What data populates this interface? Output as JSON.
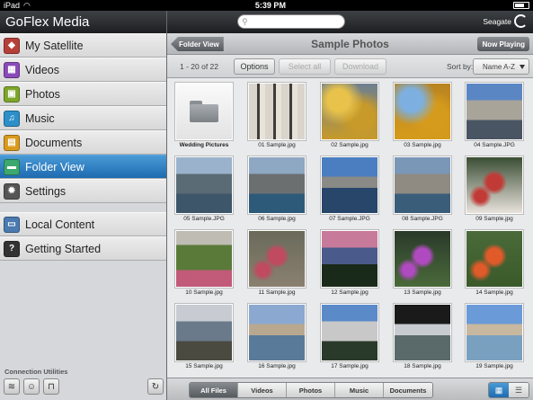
{
  "status_bar": {
    "device": "iPad",
    "time": "5:39 PM",
    "battery_percent": 0.6
  },
  "sidebar": {
    "title": "GoFlex Media",
    "items": [
      {
        "label": "My Satellite",
        "icon": "satellite-icon",
        "color": "#b5403a",
        "glyph": "◆",
        "selected": false
      },
      {
        "label": "Videos",
        "icon": "videos-icon",
        "color": "#8a4bb8",
        "glyph": "▦",
        "selected": false
      },
      {
        "label": "Photos",
        "icon": "photos-icon",
        "color": "#7ea62a",
        "glyph": "▣",
        "selected": false
      },
      {
        "label": "Music",
        "icon": "music-icon",
        "color": "#2d8fc9",
        "glyph": "♫",
        "selected": false
      },
      {
        "label": "Documents",
        "icon": "documents-icon",
        "color": "#d99a1d",
        "glyph": "▤",
        "selected": false
      },
      {
        "label": "Folder View",
        "icon": "folder-view-icon",
        "color": "#3aa86f",
        "glyph": "▬",
        "selected": true
      },
      {
        "label": "Settings",
        "icon": "settings-icon",
        "color": "#555555",
        "glyph": "✹",
        "selected": false
      }
    ],
    "items2": [
      {
        "label": "Local Content",
        "icon": "local-content-icon",
        "color": "#4a7ab0",
        "glyph": "▭"
      },
      {
        "label": "Getting Started",
        "icon": "getting-started-icon",
        "color": "#333333",
        "glyph": "?"
      }
    ],
    "footer_label": "Connection Utilities"
  },
  "topbar": {
    "search_placeholder": "",
    "brand": "Seagate"
  },
  "titlebar": {
    "back_label": "Folder View",
    "title": "Sample Photos",
    "now_playing_label": "Now Playing"
  },
  "toolbar": {
    "count": "1 - 20 of 22",
    "options_label": "Options",
    "select_all_label": "Select all",
    "download_label": "Download",
    "sort_label": "Sort by:",
    "sort_value": "Name A-Z"
  },
  "items": [
    {
      "name": "Wedding Pictures",
      "type": "folder"
    },
    {
      "name": "01 Sample.jpg",
      "colors": [
        "#d9d4cc",
        "#3f3d3a",
        "#e8e3d9"
      ],
      "style": "trees"
    },
    {
      "name": "02 Sample.jpg",
      "colors": [
        "#c79a2a",
        "#e8c24a",
        "#6d7f8f"
      ],
      "style": "foliage"
    },
    {
      "name": "03 Sample.jpg",
      "colors": [
        "#d59b1c",
        "#7db0e0",
        "#b98420"
      ],
      "style": "foliage"
    },
    {
      "name": "04 Sample.JPG",
      "colors": [
        "#5a86c4",
        "#a8a49a",
        "#4a5563"
      ],
      "style": "mountain"
    },
    {
      "name": "05 Sample.JPG",
      "colors": [
        "#9bb2cc",
        "#5b6b76",
        "#3d566a"
      ],
      "style": "mountain"
    },
    {
      "name": "06 Sample.jpg",
      "colors": [
        "#8ea7c2",
        "#6b6f70",
        "#2e5a7a"
      ],
      "style": "mountain"
    },
    {
      "name": "07 Sample.JPG",
      "colors": [
        "#4a7ec0",
        "#8a8a86",
        "#27466a"
      ],
      "style": "lake"
    },
    {
      "name": "08 Sample.JPG",
      "colors": [
        "#7a97b8",
        "#8f8a82",
        "#3a5e7a"
      ],
      "style": "mountain"
    },
    {
      "name": "09 Sample.jpg",
      "colors": [
        "#3a4e34",
        "#c23a36",
        "#e8e2dc"
      ],
      "style": "flower"
    },
    {
      "name": "10 Sample.jpg",
      "colors": [
        "#bfbcb4",
        "#5a7a3a",
        "#c25a7a"
      ],
      "style": "meadow"
    },
    {
      "name": "11 Sample.jpg",
      "colors": [
        "#6a6a5a",
        "#c04a60",
        "#8a8070"
      ],
      "style": "flower"
    },
    {
      "name": "12 Sample.jpg",
      "colors": [
        "#c87a9a",
        "#4a5a8a",
        "#1a2a1a"
      ],
      "style": "sunset"
    },
    {
      "name": "13 Sample.jpg",
      "colors": [
        "#2a3a2a",
        "#b04ac0",
        "#4a6a3a"
      ],
      "style": "flower"
    },
    {
      "name": "14 Sample.jpg",
      "colors": [
        "#4a6a3a",
        "#e05a2a",
        "#3a5a2a"
      ],
      "style": "flower"
    },
    {
      "name": "15 Sample.jpg",
      "colors": [
        "#c8ccd2",
        "#6a7a8a",
        "#4a4a40"
      ],
      "style": "mountain"
    },
    {
      "name": "16 Sample.jpg",
      "colors": [
        "#8aa8d0",
        "#b8a890",
        "#5a7a9a"
      ],
      "style": "lake"
    },
    {
      "name": "17 Sample.jpg",
      "colors": [
        "#5a8ac8",
        "#c8c8c8",
        "#2a3a2a"
      ],
      "style": "mountain"
    },
    {
      "name": "18 Sample.jpg",
      "colors": [
        "#1a1a1a",
        "#c8ccd0",
        "#5a6a6a"
      ],
      "style": "lake"
    },
    {
      "name": "19 Sample.jpg",
      "colors": [
        "#6a9ad8",
        "#c8b8a0",
        "#7aa0c0"
      ],
      "style": "lake"
    }
  ],
  "tabs": {
    "labels": [
      "All Files",
      "Videos",
      "Photos",
      "Music",
      "Documents"
    ],
    "selected": "All Files"
  },
  "view_toggle": {
    "grid_icon": "grid-view-icon",
    "list_icon": "list-view-icon",
    "selected": "grid"
  }
}
